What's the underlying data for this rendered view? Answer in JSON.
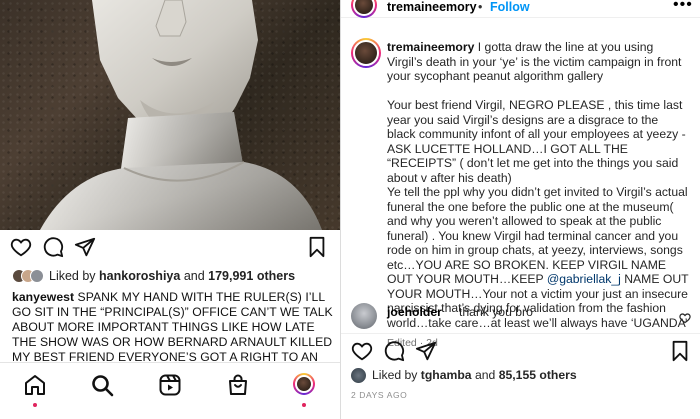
{
  "left_post": {
    "liked_by_prefix": "Liked by",
    "liked_by_user": "hankoroshiya",
    "liked_by_and": "and",
    "liked_by_count": "179,991 others",
    "caption_user": "kanyewest",
    "caption_text": " SPANK MY HAND WITH THE RULER(S)  I’LL GO SIT IN THE “PRINCIPAL(S)” OFFICE  CAN’T WE TALK ABOUT MORE IMPORTANT THINGS LIKE HOW LATE THE SHOW WAS OR HOW BERNARD ARNAULT  KILLED MY BEST FRIEND  EVERYONE’S GOT A RIGHT TO AN OPINION RIGHT THERE’S MINE",
    "icons": {
      "like": "heart-icon",
      "comment": "comment-icon",
      "share": "share-icon",
      "save": "bookmark-icon"
    }
  },
  "bottom_nav": {
    "items": [
      "home-icon",
      "search-icon",
      "reels-icon",
      "shop-icon",
      "profile-avatar"
    ]
  },
  "right_panel": {
    "header": {
      "username": "tremaineemory",
      "separator": "•",
      "follow_label": "Follow",
      "more_label": "•••"
    },
    "comment": {
      "username": "tremaineemory",
      "paragraph1": " I gotta draw the line at you using Virgil’s death in your ‘ye’ is the victim campaign in front your sycophant peanut algorithm gallery",
      "paragraph2": "Your best friend Virgil, NEGRO PLEASE , this time last year you said Virgil’s designs are a disgrace to the black community infont of all your employees at yeezy -ASK LUCETTE HOLLAND…I GOT ALL THE “RECEIPTS” ( don’t let me get into the things you said about v after his death)",
      "paragraph3_a": "Ye tell the ppl why you didn’t get invited to Virgil’s actual funeral the one before the public one at the museum( and why you weren’t allowed to speak at the public funeral) . You knew Virgil had terminal cancer and you rode on him in group chats, at yeezy, interviews, songs etc…YOU ARE SO BROKEN. KEEP VIRGIL NAME OUT YOUR MOUTH…KEEP ",
      "mention": "@gabriellak_j",
      "paragraph3_b": " NAME OUT YOUR MOUTH…Your not a victim your just an insecure narcissist that’s dying for validation from the fashion world…take care…at least we’ll always have ‘UGANDA’",
      "meta": "Edited · 2d"
    },
    "reply": {
      "username": "joeholder",
      "text": "thank you bro"
    },
    "likes": {
      "prefix": "Liked by",
      "user": "tghamba",
      "and": "and",
      "count": "85,155 others"
    },
    "date": "2 DAYS AGO"
  },
  "colors": {
    "follow_blue": "#0095f6",
    "mention": "#00376b",
    "meta_gray": "#737373",
    "notification_dot": "#e0245e"
  }
}
